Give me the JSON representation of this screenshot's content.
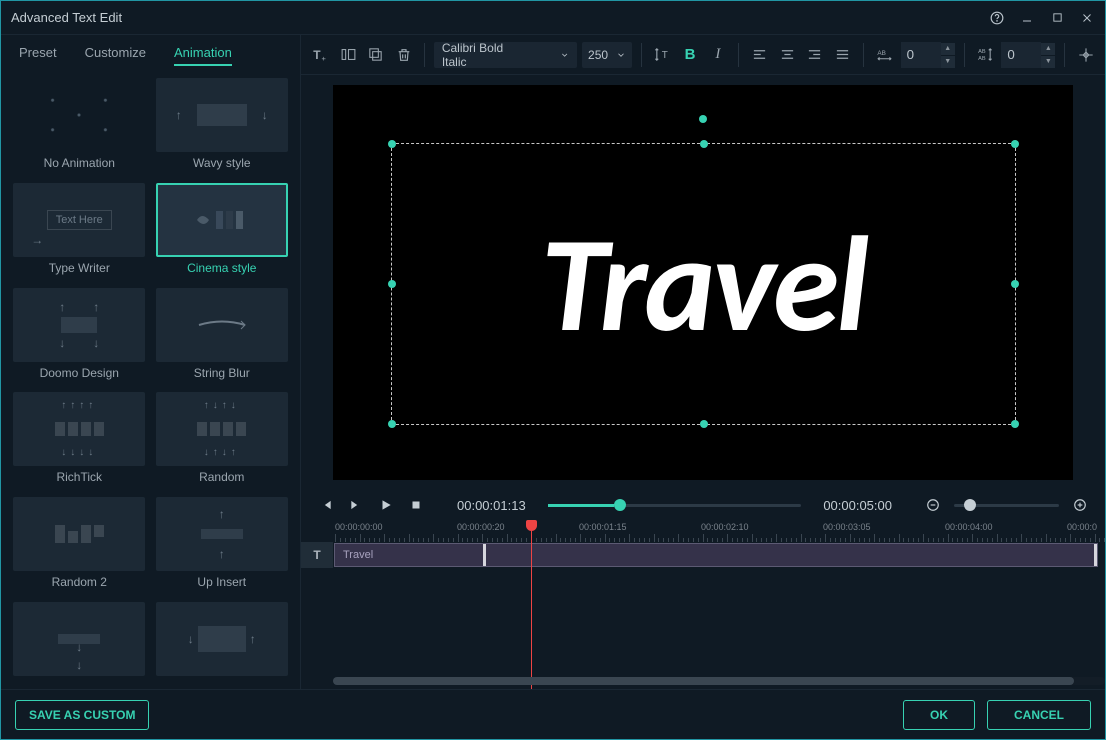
{
  "window": {
    "title": "Advanced Text Edit"
  },
  "tabs": {
    "preset": "Preset",
    "customize": "Customize",
    "animation": "Animation"
  },
  "presets": {
    "items": [
      {
        "label": "No Animation"
      },
      {
        "label": "Wavy style"
      },
      {
        "label": "Type Writer",
        "thumb_text": "Text Here"
      },
      {
        "label": "Cinema style",
        "selected": true
      },
      {
        "label": "Doomo Design"
      },
      {
        "label": "String Blur"
      },
      {
        "label": "RichTick"
      },
      {
        "label": "Random"
      },
      {
        "label": "Random 2"
      },
      {
        "label": "Up Insert"
      }
    ]
  },
  "toolbar": {
    "font": "Calibri Bold Italic",
    "size": "250",
    "tracking": "0",
    "lineheight": "0"
  },
  "preview": {
    "text": "Travel"
  },
  "playback": {
    "current": "00:00:01:13",
    "total": "00:00:05:00"
  },
  "timeline": {
    "marks": [
      "00:00:00:00",
      "00:00:00:20",
      "00:00:01:15",
      "00:00:02:10",
      "00:00:03:05",
      "00:00:04:00",
      "00:00:0"
    ],
    "clip": "Travel"
  },
  "footer": {
    "save": "SAVE AS CUSTOM",
    "ok": "OK",
    "cancel": "CANCEL"
  }
}
